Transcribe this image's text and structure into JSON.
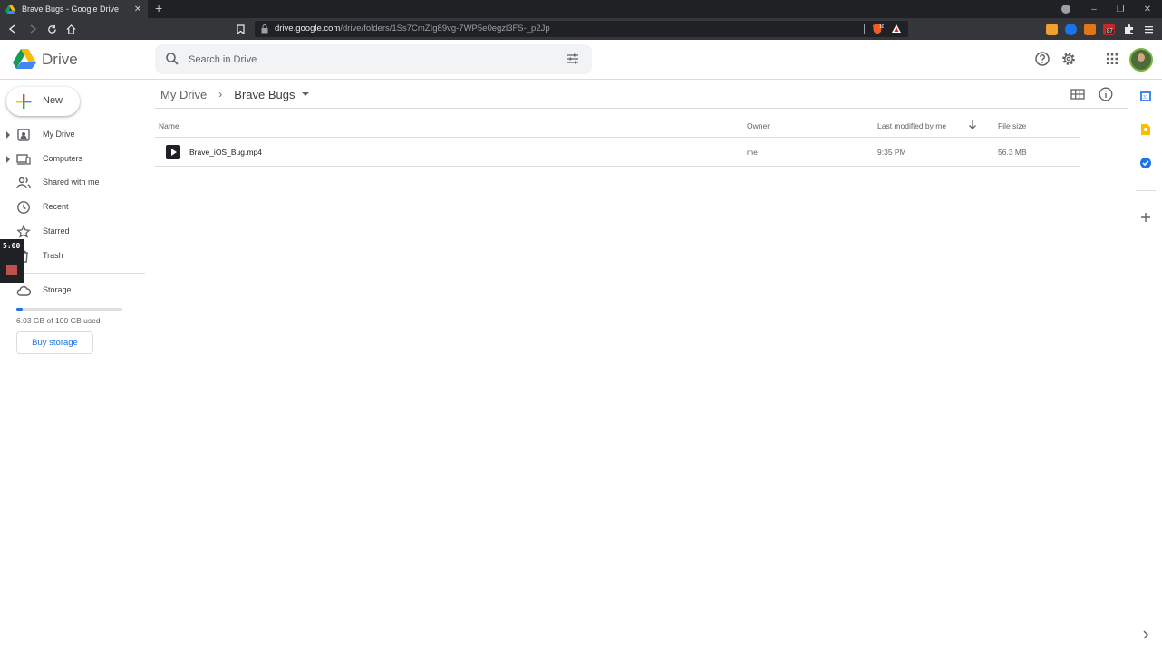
{
  "browser": {
    "tab_title": "Brave Bugs - Google Drive",
    "tab_close": "✕",
    "new_tab": "+",
    "url_host": "drive.google.com",
    "url_path": "/drive/folders/1Ss7CmZIg89vg-7WP5e0egzl3FS-_p2Jp",
    "ext_badge_count": "87",
    "shield_badge": "10"
  },
  "app": {
    "brand": "Drive",
    "search_placeholder": "Search in Drive",
    "colors": {
      "accent": "#1a73e8",
      "quota": "#1a73e8"
    }
  },
  "sidebar": {
    "new_label": "New",
    "items": [
      {
        "label": "My Drive",
        "icon": "my-drive-icon",
        "expandable": true
      },
      {
        "label": "Computers",
        "icon": "computers-icon",
        "expandable": true
      },
      {
        "label": "Shared with me",
        "icon": "shared-icon",
        "expandable": false
      },
      {
        "label": "Recent",
        "icon": "clock-icon",
        "expandable": false
      },
      {
        "label": "Starred",
        "icon": "star-icon",
        "expandable": false
      },
      {
        "label": "Trash",
        "icon": "trash-icon",
        "expandable": false
      }
    ],
    "storage_label": "Storage",
    "quota_text": "6.03 GB of 100 GB used",
    "quota_fraction": 0.0603,
    "buy_label": "Buy storage"
  },
  "overlay": {
    "timer": "5:00"
  },
  "main": {
    "breadcrumb": [
      "My Drive",
      "Brave Bugs"
    ],
    "columns": {
      "name": "Name",
      "owner": "Owner",
      "modified": "Last modified by me",
      "size": "File size"
    },
    "files": [
      {
        "name": "Brave_iOS_Bug.mp4",
        "owner": "me",
        "modified": "9:35 PM",
        "size": "56.3 MB",
        "icon": "video-file-icon"
      }
    ]
  }
}
